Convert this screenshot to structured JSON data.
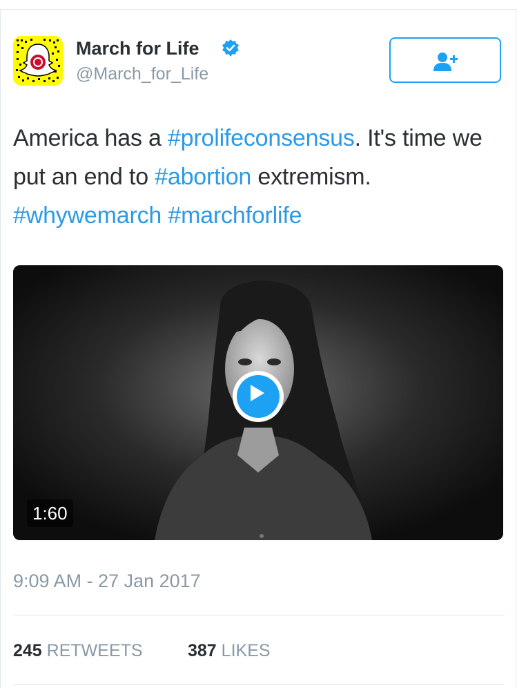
{
  "profile": {
    "display_name": "March for Life",
    "handle": "@March_for_Life",
    "verified": true,
    "avatar_icon": "snapcode-ghost-icon"
  },
  "follow_button": {
    "icon": "add-user-icon",
    "color": "#1da1f2"
  },
  "tweet": {
    "segments": [
      {
        "text": "America has a ",
        "hashtag": false
      },
      {
        "text": "#prolifeconsensus",
        "hashtag": true
      },
      {
        "text": ". It's time we put an end to ",
        "hashtag": false
      },
      {
        "text": "#abortion",
        "hashtag": true
      },
      {
        "text": " extremism. ",
        "hashtag": false
      },
      {
        "text": "#whywemarch",
        "hashtag": true
      },
      {
        "text": " ",
        "hashtag": false
      },
      {
        "text": "#marchforlife",
        "hashtag": true
      }
    ],
    "hashtag_color": "#2b9ae6"
  },
  "video": {
    "duration": "1:60",
    "play_icon": "play-icon"
  },
  "meta": {
    "timestamp": "9:09 AM - 27 Jan 2017"
  },
  "stats": {
    "retweets_count": "245",
    "retweets_label": "RETWEETS",
    "likes_count": "387",
    "likes_label": "LIKES"
  }
}
